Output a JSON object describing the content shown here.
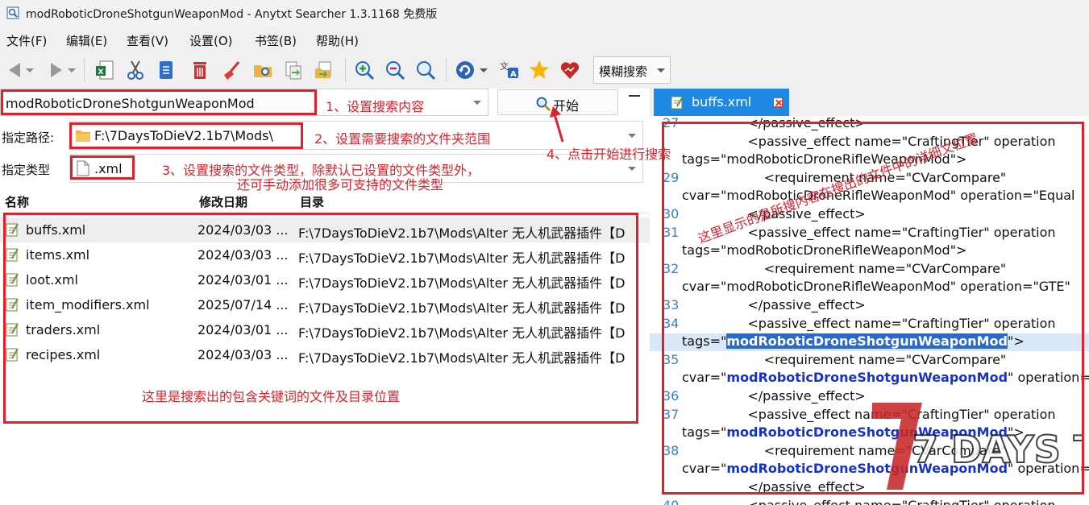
{
  "window": {
    "title": "modRoboticDroneShotgunWeaponMod - Anytxt Searcher 1.3.1168 免费版"
  },
  "menu": [
    "文件(F)",
    "编辑(E)",
    "查看(V)",
    "设置(O)",
    "书签(B)",
    "帮助(H)"
  ],
  "toolbar": {
    "search_mode": "模糊搜索"
  },
  "search": {
    "query": "modRoboticDroneShotgunWeaponMod",
    "start_label": "开始",
    "path_label": "指定路径:",
    "path_value": "F:\\7DaysToDieV2.1b7\\Mods\\",
    "type_label": "指定类型",
    "type_value": ".xml"
  },
  "results": {
    "columns": [
      "名称",
      "修改日期",
      "目录"
    ],
    "rows": [
      {
        "name": "buffs.xml",
        "date": "2024/03/03 ...",
        "dir": "F:\\7DaysToDieV2.1b7\\Mods\\Alter 无人机武器插件【D"
      },
      {
        "name": "items.xml",
        "date": "2024/03/03 ...",
        "dir": "F:\\7DaysToDieV2.1b7\\Mods\\Alter 无人机武器插件【D"
      },
      {
        "name": "loot.xml",
        "date": "2024/03/01 ...",
        "dir": "F:\\7DaysToDieV2.1b7\\Mods\\Alter 无人机武器插件【D"
      },
      {
        "name": "item_modifiers.xml",
        "date": "2025/07/14 ...",
        "dir": "F:\\7DaysToDieV2.1b7\\Mods\\Alter 无人机武器插件【D"
      },
      {
        "name": "traders.xml",
        "date": "2024/03/01 ...",
        "dir": "F:\\7DaysToDieV2.1b7\\Mods\\Alter 无人机武器插件【D"
      },
      {
        "name": "recipes.xml",
        "date": "2024/03/03 ...",
        "dir": "F:\\7DaysToDieV2.1b7\\Mods\\Alter 无人机武器插件【D"
      }
    ]
  },
  "annotations": {
    "a1": "1、设置搜索内容",
    "a2": "2、设置需要搜索的文件夹范围",
    "a3_line1": "3、设置搜索的文件类型，除默认已设置的文件类型外，",
    "a3_line2": "还可手动添加很多可支持的文件类型",
    "a4": "4、点击开始进行搜索",
    "results_note": "这里是搜索出的包含关键词的文件及目录位置",
    "preview_note": "这里显示的是所搜内容在搜出的文件中的详细文位置"
  },
  "preview": {
    "tab_label": "buffs.xml",
    "lines": [
      {
        "n": "27",
        "pre": "                </passive_effect>",
        "kw": "",
        "post": ""
      },
      {
        "n": "",
        "pre": "                <passive_effect name=\"CraftingTier\" operation",
        "kw": "",
        "post": ""
      },
      {
        "n": "",
        "pre": "tags=\"modRoboticDroneRifleWeaponMod\">",
        "kw": "",
        "post": ""
      },
      {
        "n": "29",
        "pre": "                    <requirement name=\"CVarCompare\"",
        "kw": "",
        "post": ""
      },
      {
        "n": "",
        "pre": "cvar=\"modRoboticDroneRifleWeaponMod\" operation=\"Equal",
        "kw": "",
        "post": ""
      },
      {
        "n": "30",
        "pre": "                </passive_effect>",
        "kw": "",
        "post": ""
      },
      {
        "n": "31",
        "pre": "                <passive_effect name=\"CraftingTier\" operation",
        "kw": "",
        "post": ""
      },
      {
        "n": "",
        "pre": "tags=\"modRoboticDroneRifleWeaponMod\">",
        "kw": "",
        "post": ""
      },
      {
        "n": "32",
        "pre": "                    <requirement name=\"CVarCompare\"",
        "kw": "",
        "post": ""
      },
      {
        "n": "",
        "pre": "cvar=\"modRoboticDroneRifleWeaponMod\" operation=\"GTE\"",
        "kw": "",
        "post": ""
      },
      {
        "n": "33",
        "pre": "                </passive_effect>",
        "kw": "",
        "post": ""
      },
      {
        "n": "34",
        "pre": "                <passive_effect name=\"CraftingTier\" operation",
        "kw": "",
        "post": ""
      },
      {
        "n": "",
        "pre": "tags=\"",
        "kw": "modRoboticDroneShotgunWeaponMod",
        "post": "\">",
        "hl": true
      },
      {
        "n": "35",
        "pre": "                    <requirement name=\"CVarCompare\"",
        "kw": "",
        "post": ""
      },
      {
        "n": "",
        "pre": "cvar=\"",
        "kw": "modRoboticDroneShotgunWeaponMod",
        "post": "\" operation=",
        "bold": true
      },
      {
        "n": "36",
        "pre": "                </passive_effect>",
        "kw": "",
        "post": ""
      },
      {
        "n": "37",
        "pre": "                <passive_effect name=\"CraftingTier\" operation",
        "kw": "",
        "post": ""
      },
      {
        "n": "",
        "pre": "tags=\"",
        "kw": "modRoboticDroneShotgunWeaponMod",
        "post": "\">",
        "bold": true
      },
      {
        "n": "38",
        "pre": "                    <requirement name=\"CVarCompare\"",
        "kw": "",
        "post": ""
      },
      {
        "n": "",
        "pre": "cvar=\"",
        "kw": "modRoboticDroneShotgunWeaponMod",
        "post": "\" operation=",
        "bold": true
      },
      {
        "n": "",
        "pre": "                </passive_effect>",
        "kw": "",
        "post": ""
      },
      {
        "n": "40",
        "pre": "                <passive_effect name=\"CraftingTier\" operation",
        "kw": "",
        "post": ""
      }
    ]
  },
  "watermark": {
    "text": "7 DAYS TO DIE"
  },
  "colors": {
    "accent": "#1e88e5",
    "annotation": "#e0202a",
    "keyword": "#1533c9",
    "line_number": "#3b7fd0"
  }
}
